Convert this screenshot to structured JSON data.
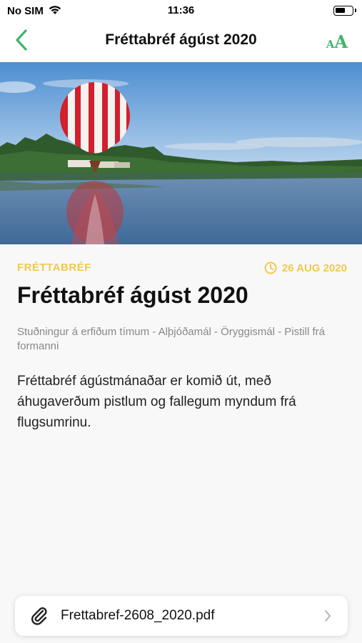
{
  "status_bar": {
    "carrier": "No SIM",
    "time": "11:36",
    "battery_level": 0.6
  },
  "nav": {
    "title": "Fréttabréf ágúst 2020",
    "back_icon": "chevron-left-icon",
    "font_size_small": "A",
    "font_size_large": "A"
  },
  "colors": {
    "accent": "#3fb56a",
    "category": "#f0c94a",
    "muted_text": "#888888"
  },
  "article": {
    "category": "FRÉTTABRÉF",
    "date": "26 AUG 2020",
    "title": "Fréttabréf ágúst 2020",
    "subtitle": "Stuðningur á erfiðum tímum - Alþjóðamál - Öryggismál - Pistill frá formanni",
    "body": "Fréttabréf ágústmánaðar er komið út, með áhugaverðum pistlum og fallegum myndum frá flugsumrinu."
  },
  "attachment": {
    "filename": "Frettabref-2608_2020.pdf",
    "icon": "paperclip-icon"
  }
}
